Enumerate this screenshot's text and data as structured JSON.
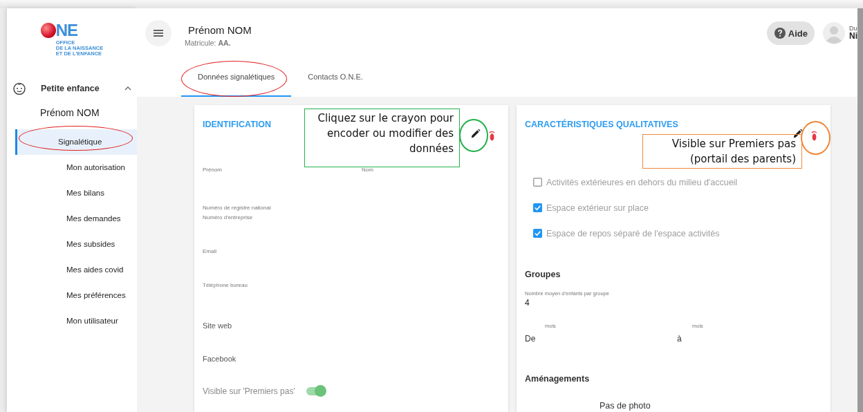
{
  "logo": {
    "mark": "NE",
    "tagline": [
      "OFFICE",
      "DE LA NAISSANCE",
      "ET DE L'ENFANCE"
    ]
  },
  "sidebar": {
    "section": {
      "label": "Petite enfance",
      "expanded": true
    },
    "person": "Prénom NOM",
    "items": [
      {
        "label": "Signalétique",
        "selected": true
      },
      {
        "label": "Mon autorisation",
        "selected": false
      },
      {
        "label": "Mes bilans",
        "selected": false
      },
      {
        "label": "Mes demandes",
        "selected": false
      },
      {
        "label": "Mes subsides",
        "selected": false
      },
      {
        "label": "Mes aides covid",
        "selected": false
      },
      {
        "label": "Mes préférences",
        "selected": false
      },
      {
        "label": "Mon utilisateur",
        "selected": false
      }
    ]
  },
  "header": {
    "name": "Prénom NOM",
    "matricule": "Matricule: **AA.**",
    "help_button": "Aide",
    "user_line_1": "Du",
    "user_line_2": "Ni"
  },
  "tabs": [
    {
      "label": "Données signalétiques",
      "selected": true
    },
    {
      "label": "Contacts O.N.E.",
      "selected": false
    }
  ],
  "identification": {
    "title": "IDENTIFICATION",
    "name_row": [
      "Prénom",
      "Nom"
    ],
    "fields": [
      {
        "kind": "info",
        "label": "Numéro de registre national"
      },
      {
        "kind": "small",
        "label": "Numéro d'entreprise"
      },
      {
        "kind": "small",
        "label": "Email"
      },
      {
        "kind": "small",
        "label": "Téléphone bureau"
      },
      {
        "kind": "large",
        "label": "Site web"
      },
      {
        "kind": "large",
        "label": "Facebook"
      }
    ],
    "visibility": {
      "label": "Visible sur 'Premiers pas'",
      "on": true
    }
  },
  "qualitative": {
    "title": "CARACTÉRISTIQUES QUALITATIVES",
    "options": [
      {
        "label": "Activités extérieures en dehors du milieu d'accueil",
        "checked": false
      },
      {
        "label": "Espace extérieur sur place",
        "checked": true
      },
      {
        "label": "Espace de repos séparé de l'espace activités",
        "checked": true
      }
    ],
    "groups_title": "Groupes",
    "group_size_label": "Nombre moyen d'enfants par groupe",
    "group_size": "4",
    "range": {
      "from": "De",
      "from_unit": "mois",
      "to": "à",
      "to_unit": "mois"
    },
    "facilities_title": "Aménagements",
    "photo_placeholder": "Pas de photo"
  },
  "annotations": [
    {
      "kind": "box",
      "text": "Cliquez sur le crayon pour encoder ou modifier des données",
      "color": "#22b14c"
    },
    {
      "kind": "box",
      "text": "Visible sur Premiers pas (portail des parents)",
      "color": "#f0883a"
    },
    {
      "kind": "ring",
      "color": "#22b14c"
    },
    {
      "kind": "ring",
      "color": "#f0883a"
    },
    {
      "kind": "ellipse",
      "color": "#e02020"
    },
    {
      "kind": "ellipse",
      "color": "#e02020"
    }
  ]
}
